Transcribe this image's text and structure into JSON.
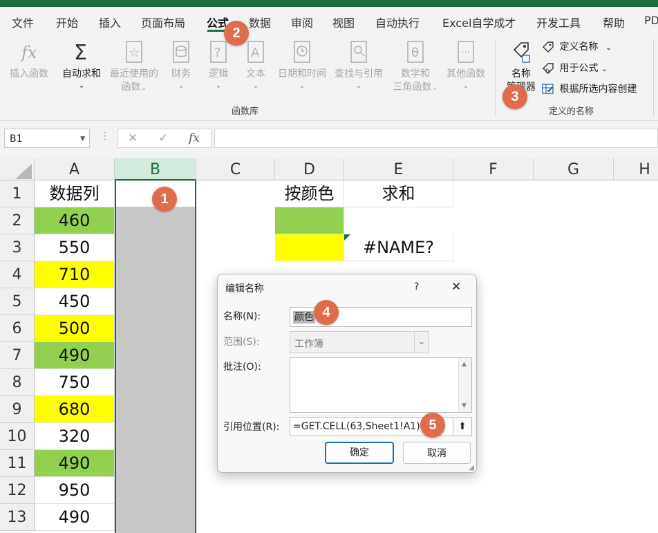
{
  "menu": {
    "tabs": [
      "文件",
      "开始",
      "插入",
      "页面布局",
      "公式",
      "数据",
      "审阅",
      "视图",
      "自动执行",
      "Excel自学成才",
      "开发工具",
      "帮助",
      "PD"
    ],
    "active": "公式"
  },
  "ribbon": {
    "buttons": {
      "insert_fn": "插入函数",
      "autosum": "自动求和",
      "recent_1": "最近使用的",
      "recent_2": "函数",
      "finance": "财务",
      "logic": "逻辑",
      "text": "文本",
      "datetime": "日期和时间",
      "lookup": "查找与引用",
      "math_1": "数学和",
      "math_2": "三角函数",
      "other": "其他函数",
      "name_mgr_1": "名称",
      "name_mgr_2": "管理器"
    },
    "group_fn_lib": "函数库",
    "group_defined_names": "定义的名称",
    "define_name": "定义名称",
    "use_in_formula": "用于公式",
    "create_from_sel": "根据所选内容创建"
  },
  "formula_bar": {
    "name_box": "B1",
    "cancel_icon": "✕",
    "enter_icon": "✓",
    "fx_icon": "fx",
    "value": ""
  },
  "sheet": {
    "columns": [
      "A",
      "B",
      "C",
      "D",
      "E",
      "F",
      "G",
      "H"
    ],
    "rows": [
      "1",
      "2",
      "3",
      "4",
      "5",
      "6",
      "7",
      "8",
      "9",
      "10",
      "11",
      "12",
      "13"
    ],
    "a_header": "数据列",
    "a_values": [
      "460",
      "550",
      "710",
      "450",
      "500",
      "490",
      "750",
      "680",
      "320",
      "490",
      "950",
      "490"
    ],
    "a_fill": [
      "green",
      "",
      "yellow",
      "",
      "yellow",
      "green",
      "",
      "yellow",
      "",
      "green",
      "",
      ""
    ],
    "d1": "按颜色",
    "e1": "求和",
    "e3": "#NAME?",
    "colors": {
      "green": "#92d050",
      "yellow": "#ffff00",
      "accent": "#1e6e42",
      "badge": "#e06c4e"
    }
  },
  "dialog": {
    "title": "编辑名称",
    "help": "?",
    "close": "✕",
    "name_label": "名称(N):",
    "name_value": "颜色",
    "scope_label": "范围(S):",
    "scope_value": "工作簿",
    "comment_label": "批注(O):",
    "ref_label": "引用位置(R):",
    "ref_value": "=GET.CELL(63,Sheet1!A1)",
    "ok": "确定",
    "cancel": "取消"
  },
  "badges": [
    "1",
    "2",
    "3",
    "4",
    "5"
  ]
}
